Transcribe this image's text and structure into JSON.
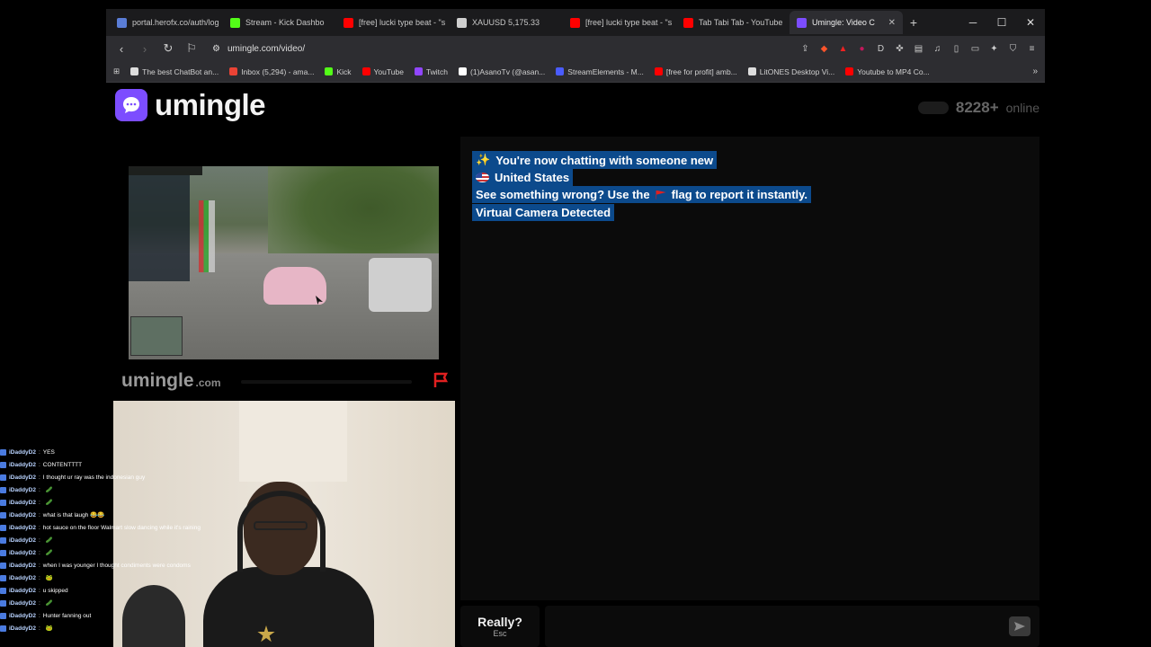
{
  "browser": {
    "tabs": [
      {
        "title": "portal.herofx.co/auth/log",
        "color": "#5a7dd6",
        "active": false
      },
      {
        "title": "Stream - Kick Dashbo",
        "color": "#53fc18",
        "active": false
      },
      {
        "title": "[free] lucki type beat - \"s",
        "color": "#ff0000",
        "active": false
      },
      {
        "title": "XAUUSD 5,175.33",
        "color": "#cfcfcf",
        "active": false
      },
      {
        "title": "[free] lucki type beat - \"s",
        "color": "#ff0000",
        "active": false
      },
      {
        "title": "Tab Tabi Tab - YouTube",
        "color": "#ff0000",
        "active": false
      },
      {
        "title": "Umingle: Video C",
        "color": "#7c4dff",
        "active": true
      }
    ],
    "new_tab_label": "+",
    "url": "umingle.com/video/",
    "bookmarks": [
      {
        "label": "The best ChatBot an...",
        "color": "#dddddd"
      },
      {
        "label": "Inbox (5,294) - ama...",
        "color": "#ea4335"
      },
      {
        "label": "Kick",
        "color": "#53fc18"
      },
      {
        "label": "YouTube",
        "color": "#ff0000"
      },
      {
        "label": "Twitch",
        "color": "#9146ff"
      },
      {
        "label": "(1)AsanoTv (@asan...",
        "color": "#ffffff"
      },
      {
        "label": "StreamElements - M...",
        "color": "#4a5cff"
      },
      {
        "label": "[free for profit] amb...",
        "color": "#ff0000"
      },
      {
        "label": "LitONES Desktop Vi...",
        "color": "#dddddd"
      },
      {
        "label": "Youtube to MP4 Co...",
        "color": "#ff0000"
      }
    ],
    "more_bookmarks": "»"
  },
  "app": {
    "name": "umingle",
    "online_count": "8228+",
    "online_label": "online",
    "watermark_main": "umingle",
    "watermark_sub": ".com",
    "accent": "#7c4dff"
  },
  "chat": {
    "lines": [
      {
        "icon": "✨",
        "text": "You're now chatting with someone new"
      },
      {
        "icon": "flag-us",
        "text": "United States"
      },
      {
        "text_before": "See something wrong? Use the",
        "text_after": "flag to report it instantly."
      },
      {
        "text": "Virtual Camera Detected"
      }
    ],
    "highlight": "#0c4a8c",
    "skip_label": "Really?",
    "skip_hint": "Esc"
  },
  "stream_chat": [
    {
      "user": "iDaddyD2",
      "text": "YES"
    },
    {
      "user": "iDaddyD2",
      "text": "CONTENTTTT"
    },
    {
      "user": "iDaddyD2",
      "text": "I thought ur ray was the indonesian guy"
    },
    {
      "user": "iDaddyD2",
      "text": "",
      "emote": "🥒"
    },
    {
      "user": "iDaddyD2",
      "text": "",
      "emote": "🥒"
    },
    {
      "user": "iDaddyD2",
      "text": "what is that laugh 😂😂"
    },
    {
      "user": "iDaddyD2",
      "text": "hot sauce on the floor Walmart slow dancing while it's raining"
    },
    {
      "user": "iDaddyD2",
      "text": "",
      "emote": "🥒"
    },
    {
      "user": "iDaddyD2",
      "text": "",
      "emote": "🥒"
    },
    {
      "user": "iDaddyD2",
      "text": "when I was younger I thought condiments were condoms"
    },
    {
      "user": "iDaddyD2",
      "text": "",
      "emote": "🐸"
    },
    {
      "user": "iDaddyD2",
      "text": "u skipped"
    },
    {
      "user": "iDaddyD2",
      "text": "",
      "emote": "🥒"
    },
    {
      "user": "iDaddyD2",
      "text": "Hunter fanning out"
    },
    {
      "user": "iDaddyD2",
      "text": "",
      "emote": "🐸"
    }
  ]
}
